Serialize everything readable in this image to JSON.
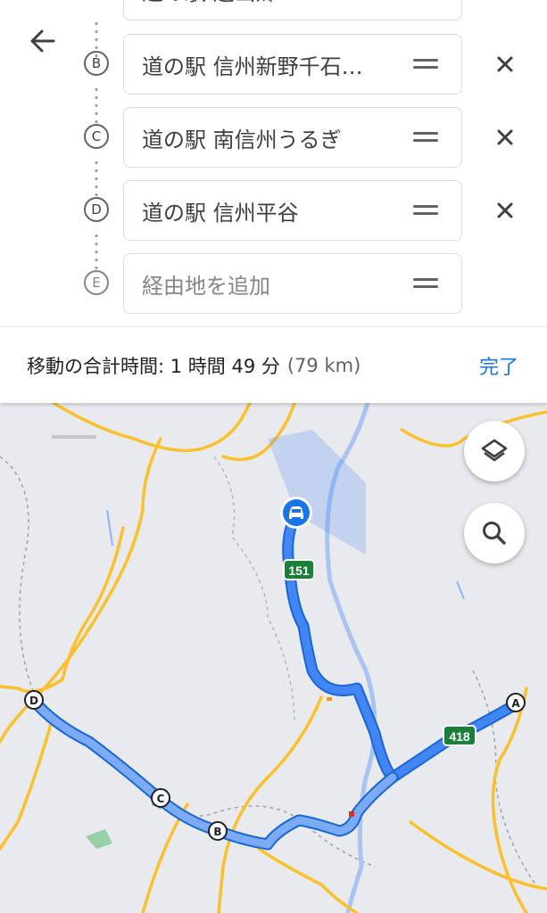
{
  "waypoints": [
    {
      "letter": "",
      "label": "道の駅 遠山郷"
    },
    {
      "letter": "B",
      "label": "道の駅 信州新野千石…"
    },
    {
      "letter": "C",
      "label": "道の駅 南信州うるぎ"
    },
    {
      "letter": "D",
      "label": "道の駅 信州平谷"
    },
    {
      "letter": "E",
      "label": "",
      "placeholder": "経由地を追加"
    }
  ],
  "summary": {
    "label": "移動の合計時間: 1 時間 49 分",
    "distance": "(79 km)",
    "done_label": "完了"
  },
  "map": {
    "route_badges": [
      "151",
      "418"
    ],
    "markers": [
      "A",
      "B",
      "C",
      "D"
    ],
    "colors": {
      "route": "#4285f4",
      "route_alt": "#8ab4f8",
      "road": "#fbc02d",
      "map_bg": "#e8eaed",
      "river": "#a9c3f2"
    }
  },
  "icons": {
    "back": "arrow-back-icon",
    "remove": "close-icon",
    "drag": "drag-handle-icon",
    "layers": "layers-icon",
    "search": "search-icon",
    "vehicle": "car-icon"
  }
}
